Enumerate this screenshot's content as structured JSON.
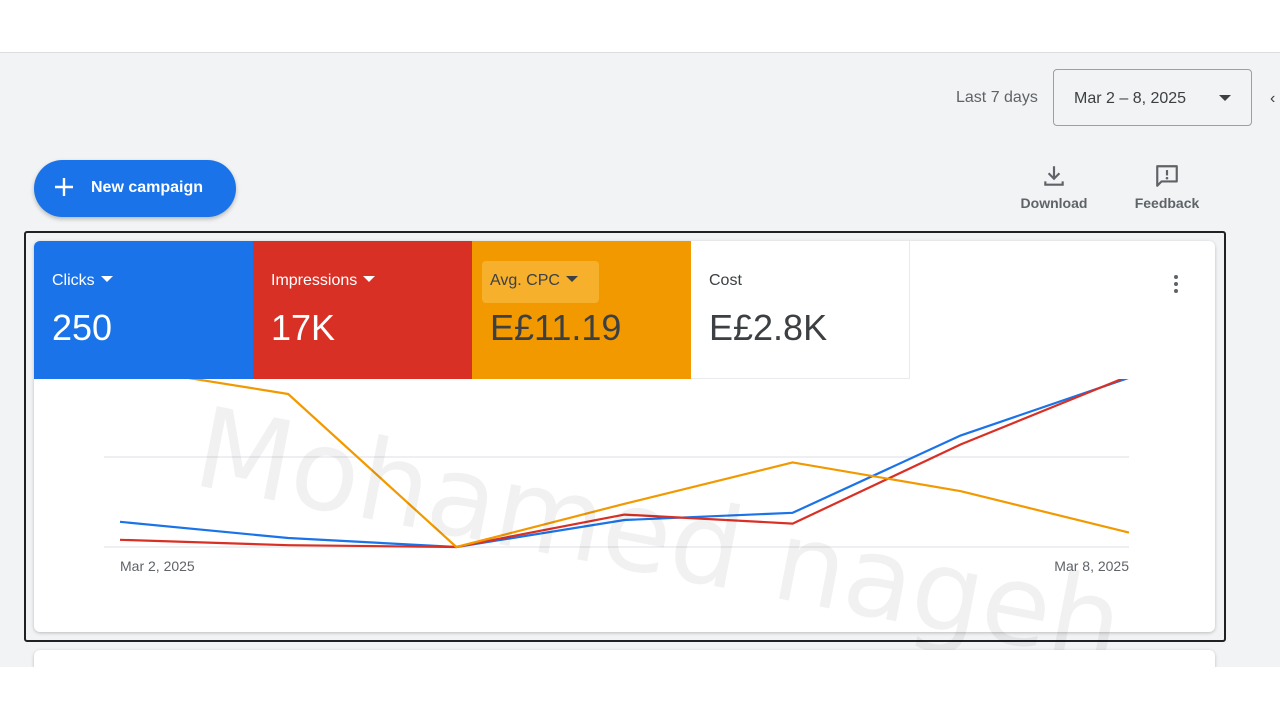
{
  "header": {
    "range_label": "Last 7 days",
    "date_range": "Mar 2 – 8, 2025",
    "collapse_icon": "chevron-left-icon"
  },
  "toolbar": {
    "new_campaign_label": "New campaign",
    "download_label": "Download",
    "feedback_label": "Feedback",
    "icons": {
      "new": "plus-icon",
      "download": "download-icon",
      "feedback": "feedback-icon",
      "more": "more-vert-icon"
    }
  },
  "metrics": [
    {
      "label": "Clicks",
      "value": "250",
      "color": "#1a73e8"
    },
    {
      "label": "Impressions",
      "value": "17K",
      "color": "#d93025"
    },
    {
      "label": "Avg. CPC",
      "value": "E£11.19",
      "color": "#f29900"
    },
    {
      "label": "Cost",
      "value": "E£2.8K",
      "color": "#ffffff"
    }
  ],
  "watermark": "Mohamed nageh",
  "chart_data": {
    "type": "line",
    "x": [
      "Mar 2, 2025",
      "Mar 3, 2025",
      "Mar 4, 2025",
      "Mar 5, 2025",
      "Mar 6, 2025",
      "Mar 7, 2025",
      "Mar 8, 2025"
    ],
    "x_tick_labels": [
      "Mar 2, 2025",
      "Mar 8, 2025"
    ],
    "y_normalized": true,
    "ylim": [
      0,
      1
    ],
    "grid": true,
    "series": [
      {
        "name": "Clicks",
        "color": "#1a73e8",
        "values": [
          0.14,
          0.05,
          0.0,
          0.15,
          0.19,
          0.62,
          0.94
        ]
      },
      {
        "name": "Impressions",
        "color": "#d93025",
        "values": [
          0.04,
          0.01,
          0.0,
          0.18,
          0.13,
          0.57,
          0.95
        ]
      },
      {
        "name": "Avg. CPC",
        "color": "#f29900",
        "values": [
          1.0,
          0.85,
          0.0,
          0.24,
          0.47,
          0.31,
          0.08
        ]
      }
    ]
  }
}
